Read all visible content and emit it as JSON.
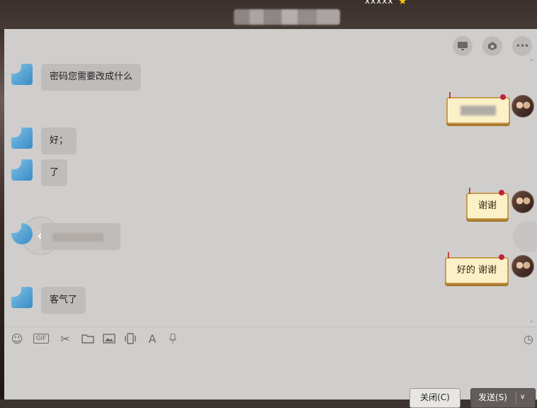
{
  "window": {
    "title_top_text": "xxxxx",
    "title_star": "★"
  },
  "chat_toolbar": {
    "screen_share_icon": "monitor-icon",
    "app_icon": "star-badge-icon",
    "more_icon": "more-icon",
    "more_label": "•••"
  },
  "messages": {
    "m1": {
      "direction": "in",
      "text": "密码您需要改成什么"
    },
    "m2": {
      "direction": "out",
      "text": ""
    },
    "m3": {
      "direction": "in",
      "text": "好；"
    },
    "m4": {
      "direction": "in",
      "text": "了"
    },
    "m5": {
      "direction": "out",
      "text": "谢谢"
    },
    "m6": {
      "direction": "in",
      "text": ""
    },
    "m7": {
      "direction": "out",
      "text": "好的 谢谢"
    },
    "m8": {
      "direction": "in",
      "text": "客气了"
    }
  },
  "nav": {
    "back_glyph": "‹",
    "scroll_up_glyph": "⌃",
    "scroll_down_glyph": "⌄"
  },
  "compose_toolbar": {
    "emoji_glyph": "☺",
    "gif_label": "GIF",
    "scissors_glyph": "✂",
    "folder_glyph": "🗀",
    "image_glyph": "▣",
    "vibrate_glyph": "▯",
    "font_glyph": "A",
    "mic_glyph": "♪",
    "history_glyph": "◷"
  },
  "buttons": {
    "close_label": "关闭(C)",
    "send_label": "发送(S)",
    "send_dropdown_glyph": "∨"
  },
  "colors": {
    "chat_bg": "#d0cecc",
    "incoming_bubble": "#bfbcba",
    "outgoing_bubble": "#fbf0c6",
    "send_button": "#625c5a"
  }
}
